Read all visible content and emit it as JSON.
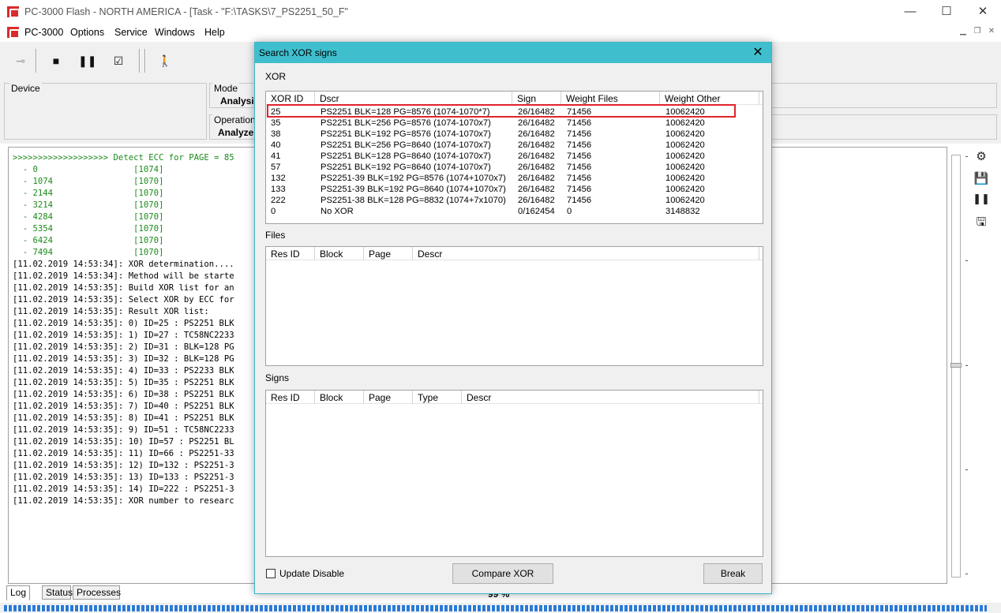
{
  "window": {
    "title": "PC-3000 Flash - NORTH AMERICA - [Task - \"F:\\TASKS\\7_PS2251_50_F\"",
    "minimize": "—",
    "maximize": "☐",
    "close": "✕"
  },
  "menu": {
    "items": [
      "PC-3000",
      "Options",
      "Service",
      "Windows",
      "Help"
    ]
  },
  "panels": {
    "device_label": "Device",
    "mode_label": "Mode",
    "mode_value": "Analysis",
    "operation_label": "Operation",
    "operation_value": "Analyze."
  },
  "log": {
    "header": ">>>>>>>>>>>>>>>>>>> Detect ECC for PAGE = 85",
    "ecc_rows": [
      {
        "offset": "  - 0",
        "value": "[1074]"
      },
      {
        "offset": "  - 1074",
        "value": "[1070]"
      },
      {
        "offset": "  - 2144",
        "value": "[1070]"
      },
      {
        "offset": "  - 3214",
        "value": "[1070]"
      },
      {
        "offset": "  - 4284",
        "value": "[1070]"
      },
      {
        "offset": "  - 5354",
        "value": "[1070]"
      },
      {
        "offset": "  - 6424",
        "value": "[1070]"
      },
      {
        "offset": "  - 7494",
        "value": "[1070]"
      }
    ],
    "lines": [
      "[11.02.2019 14:53:34]: XOR determination....",
      "[11.02.2019 14:53:34]: Method will be starte",
      "[11.02.2019 14:53:35]: Build XOR list for an",
      "[11.02.2019 14:53:35]: Select XOR by ECC for",
      "[11.02.2019 14:53:35]: Result XOR list:",
      "[11.02.2019 14:53:35]: 0) ID=25 : PS2251 BLK",
      "[11.02.2019 14:53:35]: 1) ID=27 : TC58NC2233",
      "[11.02.2019 14:53:35]: 2) ID=31 : BLK=128 PG",
      "[11.02.2019 14:53:35]: 3) ID=32 : BLK=128 PG",
      "[11.02.2019 14:53:35]: 4) ID=33 : PS2233 BLK",
      "[11.02.2019 14:53:35]: 5) ID=35 : PS2251 BLK",
      "[11.02.2019 14:53:35]: 6) ID=38 : PS2251 BLK",
      "[11.02.2019 14:53:35]: 7) ID=40 : PS2251 BLK",
      "[11.02.2019 14:53:35]: 8) ID=41 : PS2251 BLK",
      "[11.02.2019 14:53:35]: 9) ID=51 : TC58NC2233",
      "[11.02.2019 14:53:35]: 10) ID=57 : PS2251 BL",
      "[11.02.2019 14:53:35]: 11) ID=66 : PS2251-33",
      "[11.02.2019 14:53:35]: 12) ID=132 : PS2251-3",
      "[11.02.2019 14:53:35]: 13) ID=133 : PS2251-3",
      "[11.02.2019 14:53:35]: 14) ID=222 : PS2251-3",
      "[11.02.2019 14:53:35]: XOR number to researc"
    ]
  },
  "tabs": [
    "Log",
    "Status",
    "Processes"
  ],
  "progress": {
    "text": "99 %",
    "fraction": 0.99
  },
  "dialog": {
    "title": "Search XOR signs",
    "close": "✕",
    "xor_section": "XOR",
    "xor_columns": [
      "XOR ID",
      "Dscr",
      "Sign",
      "Weight Files",
      "Weight Other"
    ],
    "xor_rows": [
      [
        "25",
        "PS2251 BLK=128 PG=8576 (1074-1070*7)",
        "26/16482",
        "71456",
        "10062420"
      ],
      [
        "35",
        "PS2251 BLK=256 PG=8576 (1074-1070x7)",
        "26/16482",
        "71456",
        "10062420"
      ],
      [
        "38",
        "PS2251 BLK=192 PG=8576 (1074-1070x7)",
        "26/16482",
        "71456",
        "10062420"
      ],
      [
        "40",
        "PS2251 BLK=256 PG=8640 (1074-1070x7)",
        "26/16482",
        "71456",
        "10062420"
      ],
      [
        "41",
        "PS2251 BLK=128 PG=8640 (1074-1070x7)",
        "26/16482",
        "71456",
        "10062420"
      ],
      [
        "57",
        "PS2251 BLK=192 PG=8640 (1074-1070x7)",
        "26/16482",
        "71456",
        "10062420"
      ],
      [
        "132",
        "PS2251-39 BLK=192 PG=8576 (1074+1070x7)",
        "26/16482",
        "71456",
        "10062420"
      ],
      [
        "133",
        "PS2251-39 BLK=192 PG=8640 (1074+1070x7)",
        "26/16482",
        "71456",
        "10062420"
      ],
      [
        "222",
        "PS2251-38 BLK=128 PG=8832 (1074+7x1070)",
        "26/16482",
        "71456",
        "10062420"
      ],
      [
        "0",
        "No XOR",
        "0/162454",
        "0",
        "3148832"
      ]
    ],
    "files_section": "Files",
    "files_columns": [
      "Res ID",
      "Block",
      "Page",
      "Descr"
    ],
    "signs_section": "Signs",
    "signs_columns": [
      "Res ID",
      "Block",
      "Page",
      "Type",
      "Descr"
    ],
    "update_disable": "Update Disable",
    "compare_button": "Compare XOR",
    "break_button": "Break"
  },
  "colors": {
    "dialog_title": "#3fbfce",
    "highlight": "#e0242a",
    "log_green": "#1b8a1b",
    "progress": "#2b7ad6"
  }
}
